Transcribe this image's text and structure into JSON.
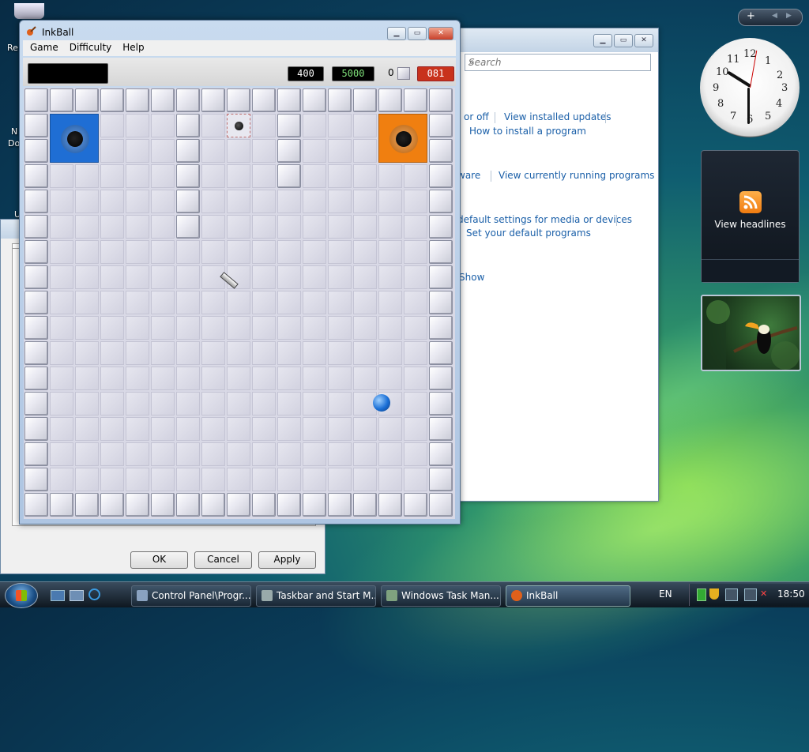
{
  "desktop": {
    "icon_labels": [
      "Re",
      "N",
      "Do",
      "U"
    ]
  },
  "control_panel": {
    "search_placeholder": "Search",
    "links": [
      "or off",
      "View installed updates",
      "How to install a program",
      "ware",
      "View currently running programs",
      "default settings for media or devices",
      "Set your default programs",
      "Show"
    ]
  },
  "properties_dialog": {
    "ok": "OK",
    "cancel": "Cancel",
    "apply": "Apply"
  },
  "inkball": {
    "title": "InkBall",
    "menu": [
      "Game",
      "Difficulty",
      "Help"
    ],
    "score": "400",
    "target": "5000",
    "balls_remaining": "0",
    "timer": "081",
    "colors": {
      "hole_blue": "#1f6ed4",
      "hole_orange": "#f07f10",
      "ball_blue": "#1a6fd6",
      "score_text": "#ffffff",
      "target_text": "#7fe07a",
      "timer_bg": "#c8321c"
    }
  },
  "gadgets": {
    "feed_label": "View headlines",
    "clock_numbers": [
      "12",
      "1",
      "2",
      "3",
      "4",
      "5",
      "6",
      "7",
      "8",
      "9",
      "10",
      "11"
    ],
    "clock_time": "18:50"
  },
  "taskbar": {
    "buttons": [
      "Control Panel\\Progr...",
      "Taskbar and Start M...",
      "Windows Task Man...",
      "InkBall"
    ],
    "language": "EN",
    "time": "18:50"
  }
}
